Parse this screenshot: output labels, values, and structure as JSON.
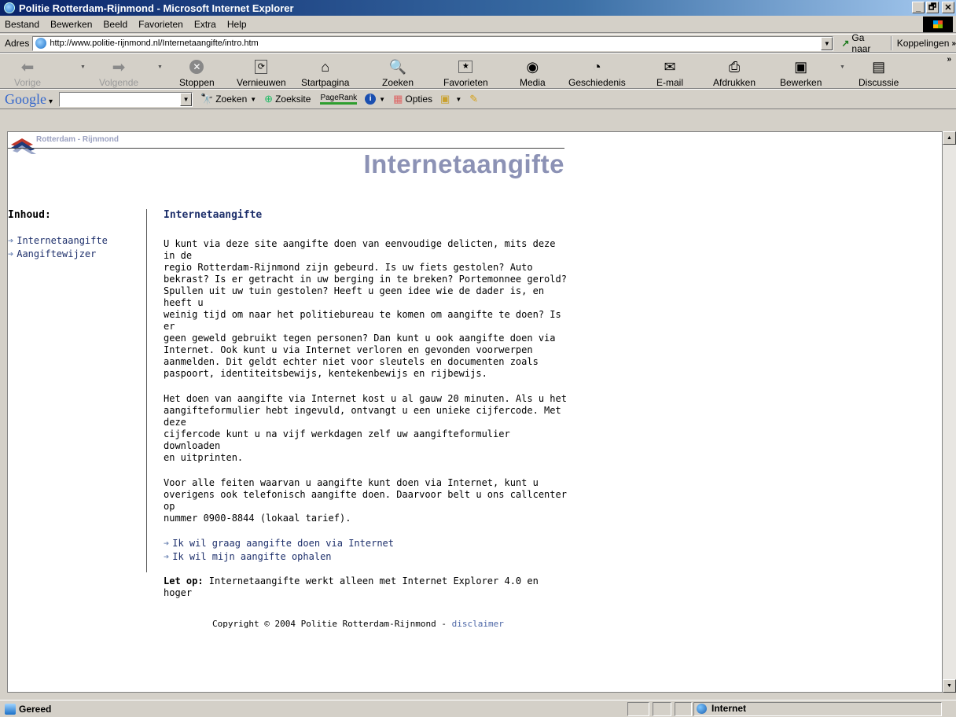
{
  "window": {
    "title": "Politie Rotterdam-Rijnmond - Microsoft Internet Explorer",
    "buttons": [
      "_",
      "🗗",
      "✕"
    ]
  },
  "menu": [
    "Bestand",
    "Bewerken",
    "Beeld",
    "Favorieten",
    "Extra",
    "Help"
  ],
  "address": {
    "label": "Adres",
    "url": "http://www.politie-rijnmond.nl/Internetaangifte/intro.htm",
    "go": "Ga naar",
    "links": "Koppelingen"
  },
  "toolbar": {
    "back": "Vorige",
    "forward": "Volgende",
    "stop": "Stoppen",
    "refresh": "Vernieuwen",
    "home": "Startpagina",
    "search": "Zoeken",
    "favorites": "Favorieten",
    "media": "Media",
    "history": "Geschiedenis",
    "mail": "E-mail",
    "print": "Afdrukken",
    "edit": "Bewerken",
    "discuss": "Discussie"
  },
  "google": {
    "logo": "Google",
    "search_btn": "Zoeken",
    "site_btn": "Zoeksite",
    "pagerank": "PageRank",
    "options": "Opties"
  },
  "page": {
    "org": "Rotterdam - Rijnmond",
    "title": "Internetaangifte",
    "sidebar_heading": "Inhoud:",
    "sidebar_links": [
      "Internetaangifte",
      "Aangiftewijzer"
    ],
    "heading": "Internetaangifte",
    "para1_lines": [
      "U kunt via deze site aangifte doen van eenvoudige delicten, mits deze in de",
      "regio Rotterdam-Rijnmond zijn gebeurd. Is uw fiets gestolen? Auto",
      "bekrast? Is er getracht in uw berging in te breken? Portemonnee gerold?",
      "Spullen uit uw tuin gestolen? Heeft u geen idee wie de dader is, en heeft u",
      "weinig tijd om naar het politiebureau te komen om aangifte te doen? Is er",
      "geen geweld gebruikt tegen personen? Dan kunt u ook aangifte doen via",
      "Internet. Ook kunt u via Internet verloren en gevonden voorwerpen",
      "aanmelden. Dit geldt echter niet voor sleutels en documenten zoals",
      "paspoort, identiteitsbewijs, kentekenbewijs en rijbewijs."
    ],
    "para2_lines": [
      "Het doen van aangifte via Internet kost u al gauw 20 minuten. Als u het",
      "aangifteformulier hebt ingevuld, ontvangt u een unieke cijfercode. Met deze",
      "cijfercode kunt u na vijf werkdagen zelf uw aangifteformulier downloaden",
      "en uitprinten."
    ],
    "para3_lines": [
      "Voor alle feiten waarvan u aangifte kunt doen via Internet, kunt u",
      "overigens ook telefonisch aangifte doen. Daarvoor belt u ons callcenter op",
      "nummer 0900-8844 (lokaal tarief)."
    ],
    "action_links": [
      "Ik wil graag aangifte doen via Internet",
      "Ik wil mijn aangifte ophalen"
    ],
    "note_label": "Let op:",
    "note_text": " Internetaangifte werkt alleen met Internet Explorer 4.0 en hoger",
    "copyright": "Copyright © 2004 Politie Rotterdam-Rijnmond - ",
    "disclaimer": "disclaimer"
  },
  "status": {
    "text": "Gereed",
    "zone": "Internet"
  }
}
